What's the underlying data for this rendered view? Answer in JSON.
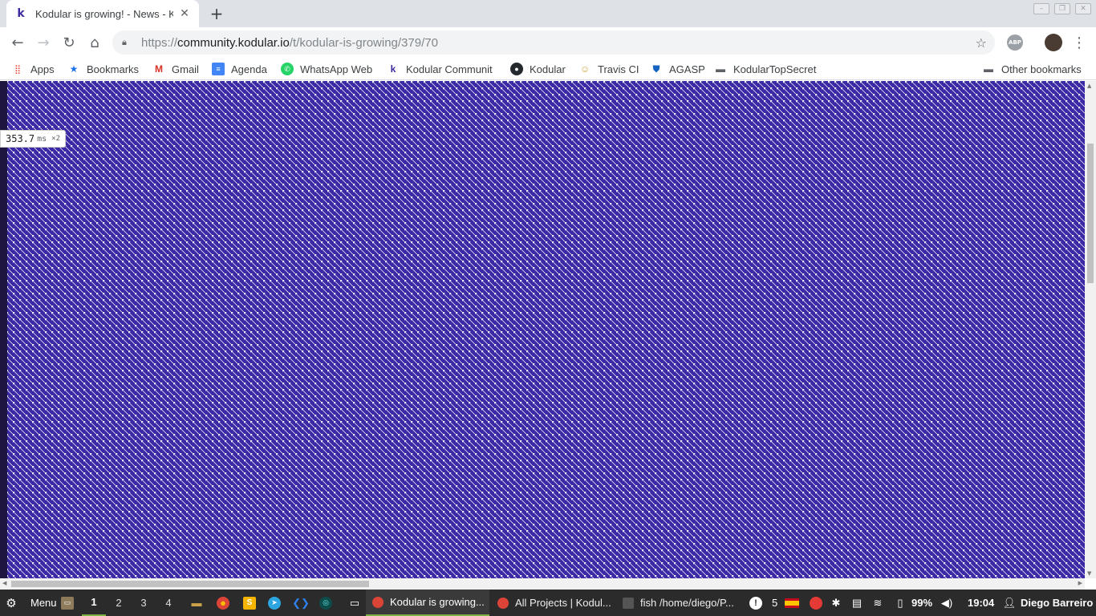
{
  "browser": {
    "tab": {
      "title": "Kodular is growing! - News - K",
      "favicon": "k",
      "close": "✕"
    },
    "new_tab": "+",
    "url": {
      "scheme": "https://",
      "host": "community.kodular.io",
      "path": "/t/kodular-is-growing/379/70"
    },
    "ext_abp": "ABP"
  },
  "bookmarks": [
    {
      "label": "Apps",
      "icon": "apps-grid-icon"
    },
    {
      "label": "Bookmarks",
      "icon": "star-icon"
    },
    {
      "label": "Gmail",
      "icon": "gmail-icon"
    },
    {
      "label": "Agenda",
      "icon": "docs-icon"
    },
    {
      "label": "WhatsApp Web",
      "icon": "whatsapp-icon"
    },
    {
      "label": "Kodular Communit",
      "icon": "kodular-icon"
    },
    {
      "label": "Kodular",
      "icon": "github-icon"
    },
    {
      "label": "Travis CI",
      "icon": "travis-icon"
    },
    {
      "label": "AGASP",
      "icon": "shield-icon"
    },
    {
      "label": "KodularTopSecret",
      "icon": "folder-icon"
    }
  ],
  "other_bookmarks": "Other bookmarks",
  "perf": {
    "value": "353.7",
    "unit": "ms",
    "mult": "×2"
  },
  "taskbar": {
    "menu": "Menu",
    "workspaces": [
      "1",
      "2",
      "3",
      "4"
    ],
    "windows": [
      {
        "label": "Kodular is growing...",
        "active": true
      },
      {
        "label": "All Projects | Kodul...",
        "active": false
      },
      {
        "label": "fish  /home/diego/P...",
        "active": false
      }
    ],
    "notif_count": "5",
    "battery": "99%",
    "time": "19:04",
    "user": "Diego Barreiro"
  },
  "colors": {
    "pattern_bg": "#3b2aa5",
    "taskbar": "#2b2b2b",
    "accent": "#7cb342"
  }
}
